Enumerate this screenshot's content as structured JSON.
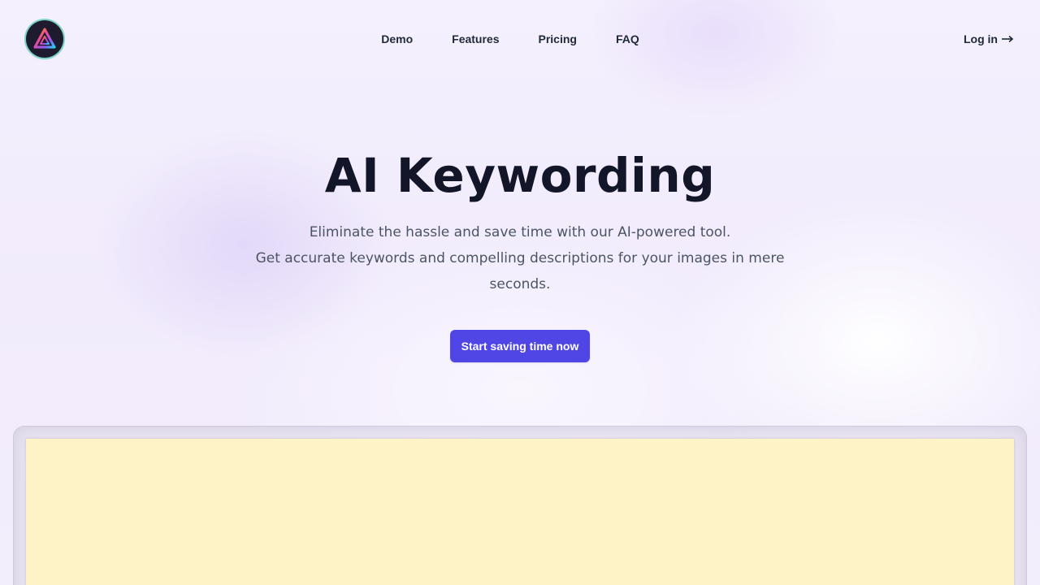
{
  "header": {
    "logo_icon": "triangle-logo-icon",
    "nav": [
      {
        "label": "Demo"
      },
      {
        "label": "Features"
      },
      {
        "label": "Pricing"
      },
      {
        "label": "FAQ"
      }
    ],
    "login_label": "Log in",
    "login_icon": "arrow-right-icon"
  },
  "hero": {
    "title": "AI Keywording",
    "subtitle_line1": "Eliminate the hassle and save time with our AI-powered tool.",
    "subtitle_line2": "Get accurate keywords and compelling descriptions for your images in mere seconds.",
    "cta_label": "Start saving time now"
  },
  "colors": {
    "accent": "#4f46e5",
    "background": "#f3eefc",
    "preview_fill": "#fef3c7",
    "title": "#131629"
  }
}
